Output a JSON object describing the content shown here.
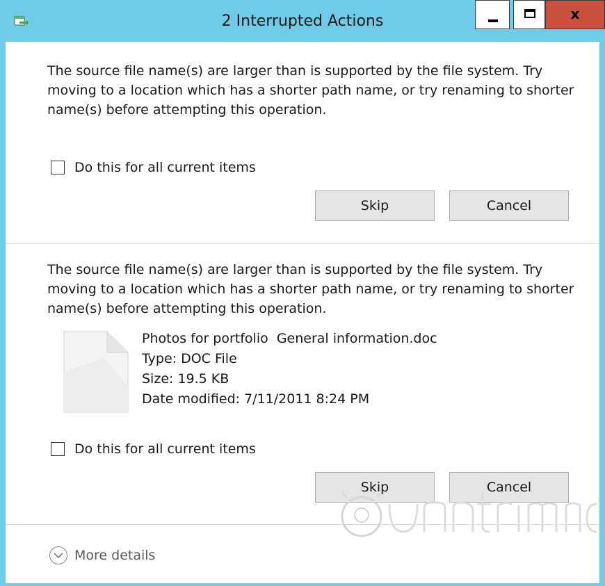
{
  "window": {
    "title": "2 Interrupted Actions",
    "close_glyph": "x",
    "icons": {
      "app": "file-transfer-icon",
      "minimize": "minimize-icon",
      "maximize": "maximize-icon",
      "close": "close-icon"
    },
    "colors": {
      "titlebar": "#6fcbe8",
      "close": "#c7503f"
    }
  },
  "actions": [
    {
      "message": "The source file name(s) are larger than is supported by the file system. Try moving to a location which has a shorter path name, or try renaming to shorter name(s) before attempting this operation.",
      "checkbox_label": "Do this for all current items",
      "checked": false,
      "skip_label": "Skip",
      "cancel_label": "Cancel"
    },
    {
      "message": "The source file name(s) are larger than is supported by the file system. Try moving to a location which has a shorter path name, or try renaming to shorter name(s) before attempting this operation.",
      "file": {
        "icon": "document-icon",
        "name": "Photos for portfolio  General information.doc",
        "type": "Type: DOC File",
        "size": "Size: 19.5 KB",
        "modified": "Date modified: 7/11/2011 8:24 PM"
      },
      "checkbox_label": "Do this for all current items",
      "checked": false,
      "skip_label": "Skip",
      "cancel_label": "Cancel"
    }
  ],
  "footer": {
    "more_details_label": "More details",
    "icon": "chevron-down-icon"
  }
}
